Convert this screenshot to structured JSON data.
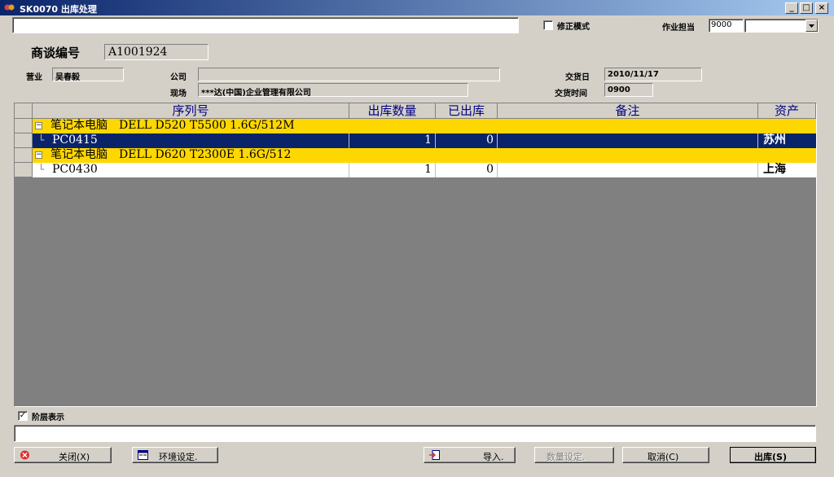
{
  "window": {
    "title": "SK0070 出库处理",
    "min": "_",
    "max": "□",
    "close": "×"
  },
  "toolbar": {
    "scan_value": "",
    "correction_label": "修正模式",
    "correction_checked": false,
    "operator_label": "作业担当",
    "operator_code": "9000",
    "operator_name": ""
  },
  "header": {
    "deal_no_label": "商谈编号",
    "deal_no": "A1001924",
    "sales_label": "营业",
    "sales": "吴春毅",
    "company_label": "公司",
    "company": "",
    "site_label": "现场",
    "site": "***达(中国)企业管理有限公司",
    "delivery_date_label": "交货日",
    "delivery_date": "2010/11/17",
    "delivery_time_label": "交货时间",
    "delivery_time": "0900"
  },
  "grid": {
    "columns": [
      "序列号",
      "出库数量",
      "已出库",
      "备注",
      "资产"
    ],
    "groups": [
      {
        "title": "笔记本电脑　DELL D520 T5500 1.6G/512M",
        "expander": "−",
        "items": [
          {
            "serial": "PC0415",
            "qty": "1",
            "shipped": "0",
            "note": "",
            "asset": "苏州",
            "selected": true
          }
        ]
      },
      {
        "title": "笔记本电脑　DELL D620 T2300E 1.6G/512",
        "expander": "−",
        "items": [
          {
            "serial": "PC0430",
            "qty": "1",
            "shipped": "0",
            "note": "",
            "asset": "上海",
            "selected": false
          }
        ]
      }
    ],
    "tree_glyph": "└"
  },
  "hierarchy": {
    "label": "阶层表示",
    "checked": true,
    "check_glyph": "✓"
  },
  "message": "",
  "buttons": {
    "close": "关闭(X)",
    "env": "环境设定.",
    "import": "导入.",
    "qty_setting": "数量设定.",
    "cancel": "取消(C)",
    "ship": "出库(S)"
  },
  "colors": {
    "group_row": "#ffd700",
    "selected_row": "#0a246a",
    "header_text": "#000080"
  }
}
